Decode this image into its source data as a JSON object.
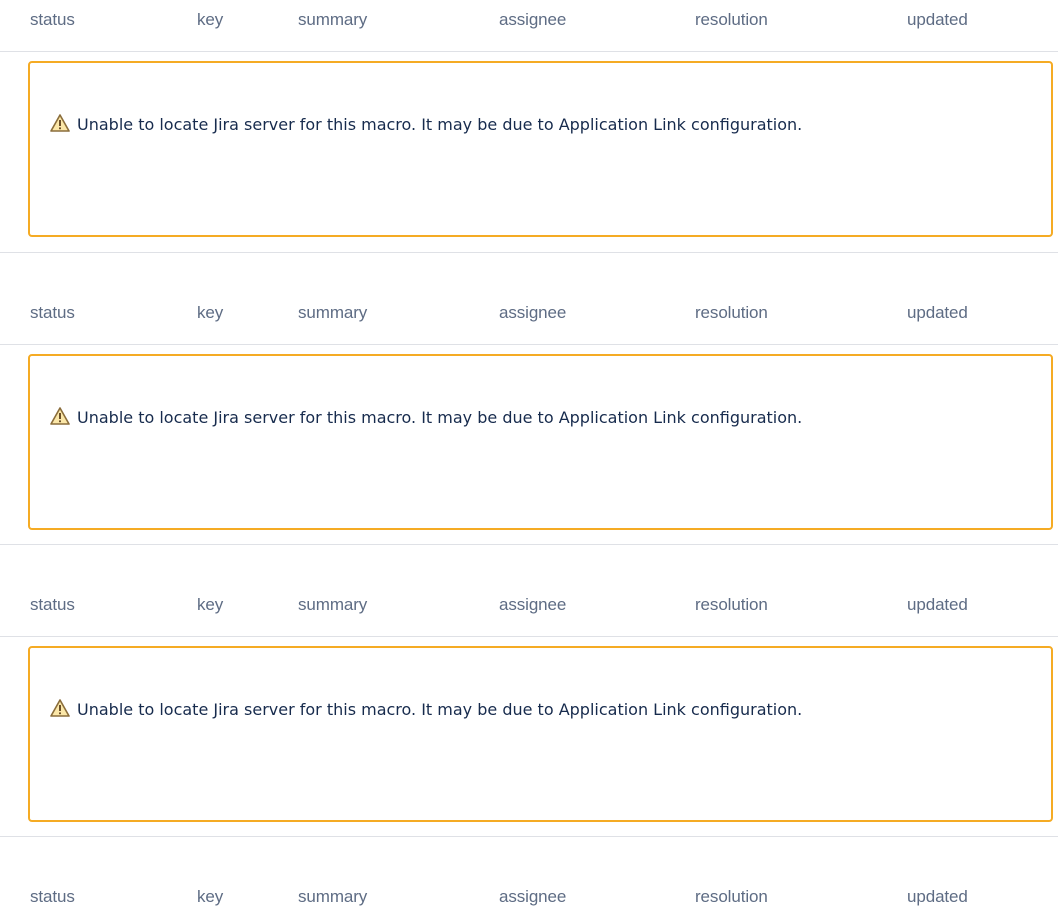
{
  "table_headers": [
    "status",
    "key",
    "summary",
    "assignee",
    "resolution",
    "updated"
  ],
  "error_message": "Unable to locate Jira server for this macro. It may be due to Application Link configuration.",
  "colors": {
    "header_text": "#5e6c84",
    "warning_border": "#f5ab24",
    "body_text": "#172b4d",
    "divider": "#dfe1e6"
  },
  "icons": {
    "warning": "warning-triangle-icon"
  },
  "macros": [
    {
      "headers": [
        "status",
        "key",
        "summary",
        "assignee",
        "resolution",
        "updated"
      ],
      "message": "Unable to locate Jira server for this macro. It may be due to Application Link configuration."
    },
    {
      "headers": [
        "status",
        "key",
        "summary",
        "assignee",
        "resolution",
        "updated"
      ],
      "message": "Unable to locate Jira server for this macro. It may be due to Application Link configuration."
    },
    {
      "headers": [
        "status",
        "key",
        "summary",
        "assignee",
        "resolution",
        "updated"
      ],
      "message": "Unable to locate Jira server for this macro. It may be due to Application Link configuration."
    },
    {
      "headers": [
        "status",
        "key",
        "summary",
        "assignee",
        "resolution",
        "updated"
      ],
      "message": null
    }
  ]
}
